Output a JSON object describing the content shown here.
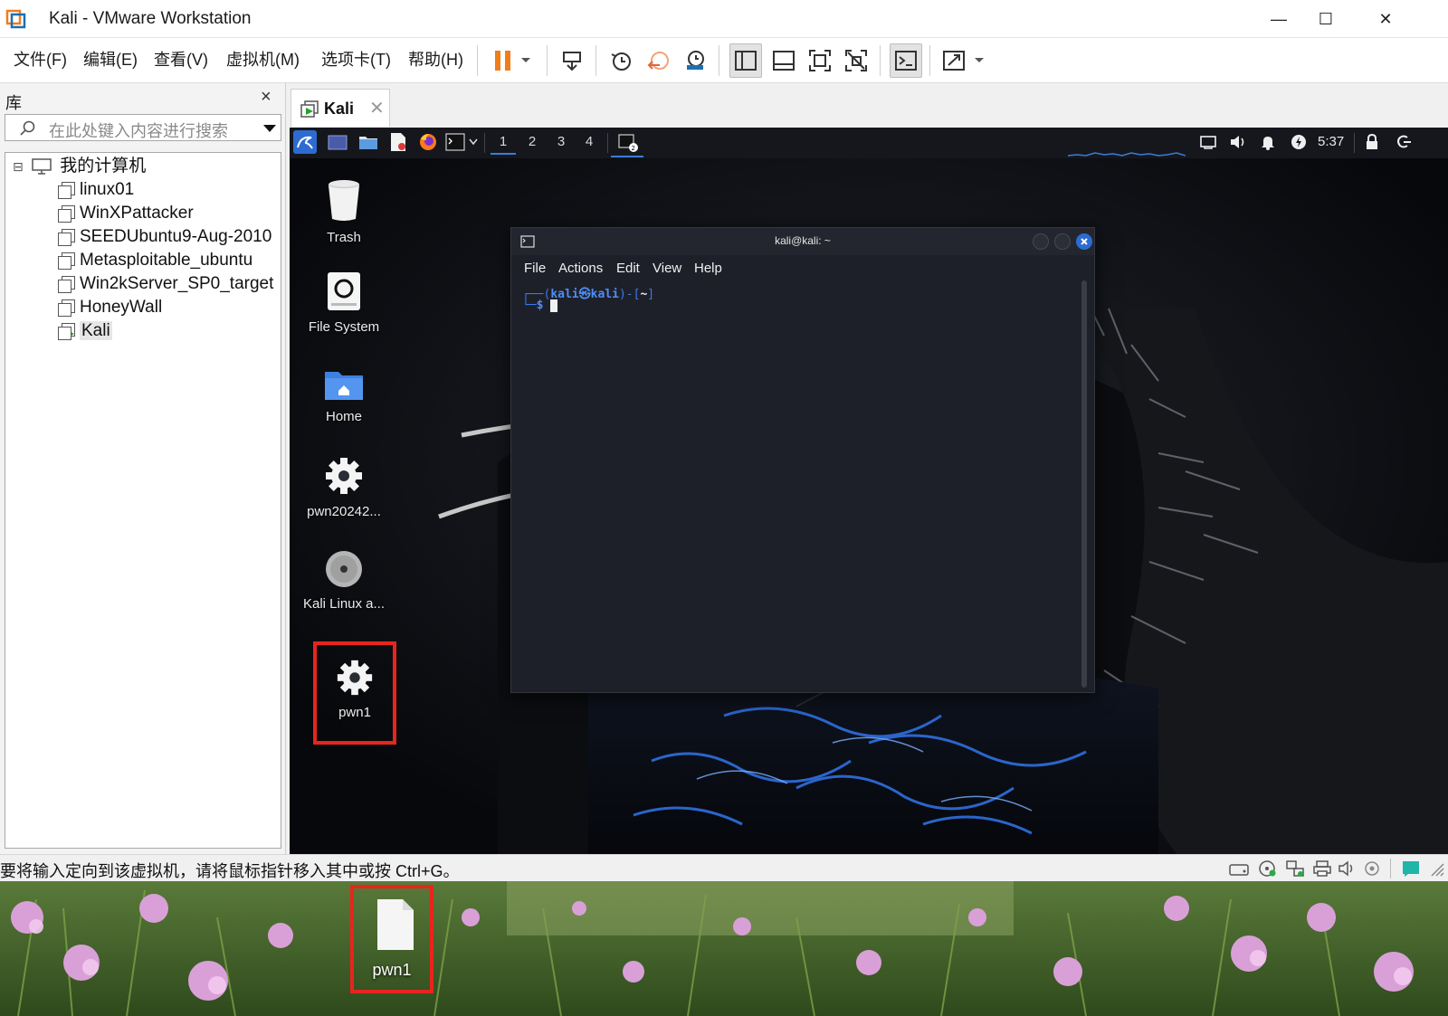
{
  "window": {
    "title": "Kali - VMware Workstation",
    "min_label": "—",
    "max_label": "☐",
    "close_label": "✕"
  },
  "menu": {
    "items": [
      "文件(F)",
      "编辑(E)",
      "查看(V)",
      "虚拟机(M)",
      "选项卡(T)",
      "帮助(H)"
    ]
  },
  "library": {
    "title": "库",
    "close": "×",
    "search_placeholder": "在此处键入内容进行搜索",
    "root": "我的计算机",
    "root_toggle": "⊟",
    "vms": [
      "linux01",
      "WinXPattacker",
      "SEEDUbuntu9-Aug-2010",
      "Metasploitable_ubuntu",
      "Win2kServer_SP0_target",
      "HoneyWall",
      "Kali"
    ],
    "selected": "Kali"
  },
  "tab": {
    "label": "Kali",
    "close": "✕"
  },
  "guest": {
    "workspaces": [
      "1",
      "2",
      "3",
      "4"
    ],
    "active_workspace": "1",
    "clock": "5:37",
    "desktop_icons": [
      {
        "label": "Trash",
        "icon": "trash-icon"
      },
      {
        "label": "File System",
        "icon": "drive-icon"
      },
      {
        "label": "Home",
        "icon": "home-folder-icon"
      },
      {
        "label": "pwn20242...",
        "icon": "gear-icon"
      },
      {
        "label": "Kali Linux a...",
        "icon": "disc-icon"
      },
      {
        "label": "pwn1",
        "icon": "gear-icon"
      }
    ],
    "terminal": {
      "title": "kali@kali: ~",
      "menu": [
        "File",
        "Actions",
        "Edit",
        "View",
        "Help"
      ],
      "prompt_user": "kali",
      "prompt_sym": "㉿",
      "prompt_host": "kali",
      "prompt_dir": "~",
      "prompt_char": "$"
    }
  },
  "statusbar": {
    "message": "要将输入定向到该虚拟机，请将鼠标指针移入其中或按 Ctrl+G。"
  },
  "host_desktop": {
    "file_label": "pwn1"
  },
  "colors": {
    "highlight_box": "#e8251c",
    "kali_blue": "#3d7bd9",
    "pause_orange": "#f07d1a"
  }
}
